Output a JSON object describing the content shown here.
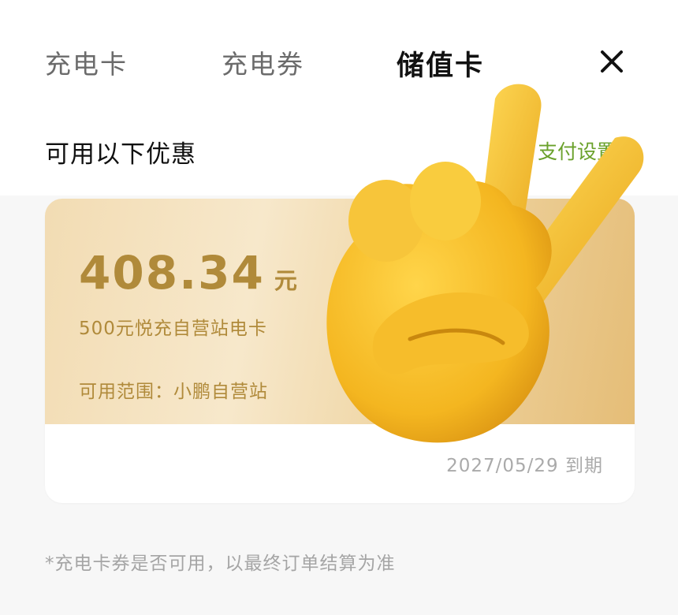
{
  "tabs": [
    {
      "label": "充电卡",
      "active": false
    },
    {
      "label": "充电券",
      "active": false
    },
    {
      "label": "储值卡",
      "active": true
    }
  ],
  "header": {
    "close_icon": "close-icon"
  },
  "section": {
    "title": "可用以下优惠",
    "pay_settings": "支付设置"
  },
  "card": {
    "amount": "408.34",
    "unit": "元",
    "name": "500元悦充自营站电卡",
    "scope": "可用范围：小鹏自营站",
    "expiry": "2027/05/29 到期"
  },
  "footnote": "*充电卡券是否可用，以最终订单结算为准",
  "overlay": {
    "icon": "victory-hand-emoji"
  },
  "colors": {
    "accent_gold": "#b08a3a",
    "link_green": "#6aa12b",
    "emoji_yellow": "#f2b21a"
  }
}
